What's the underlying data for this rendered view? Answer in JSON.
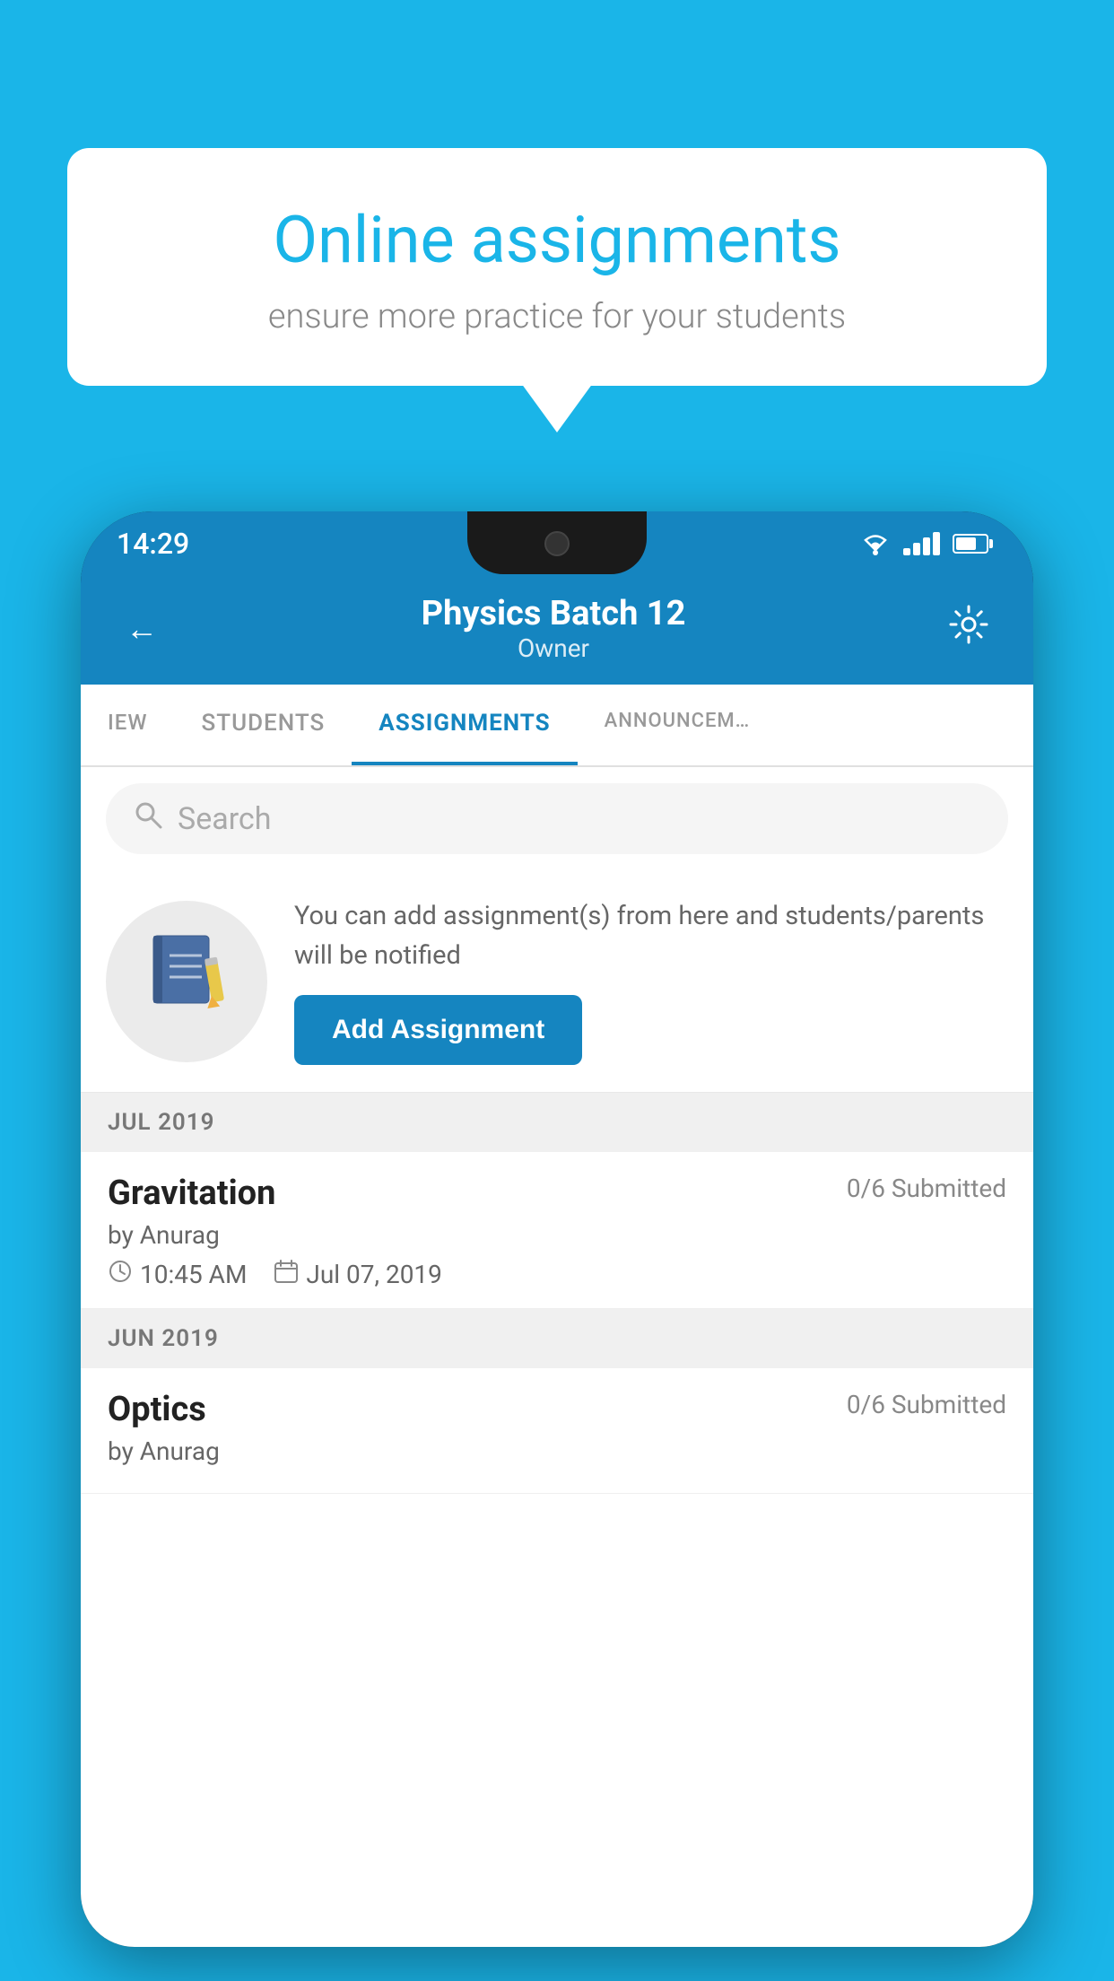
{
  "background_color": "#1ab5e8",
  "speech_bubble": {
    "title": "Online assignments",
    "subtitle": "ensure more practice for your students"
  },
  "status_bar": {
    "time": "14:29"
  },
  "header": {
    "title": "Physics Batch 12",
    "subtitle": "Owner",
    "back_label": "←",
    "settings_label": "⚙"
  },
  "tabs": [
    {
      "label": "IEW",
      "active": false
    },
    {
      "label": "STUDENTS",
      "active": false
    },
    {
      "label": "ASSIGNMENTS",
      "active": true
    },
    {
      "label": "ANNOUNCEM…",
      "active": false
    }
  ],
  "search": {
    "placeholder": "Search"
  },
  "promo": {
    "description": "You can add assignment(s) from here and students/parents will be notified",
    "button_label": "Add Assignment"
  },
  "sections": [
    {
      "header": "JUL 2019",
      "assignments": [
        {
          "title": "Gravitation",
          "submitted": "0/6 Submitted",
          "by": "by Anurag",
          "time": "10:45 AM",
          "date": "Jul 07, 2019"
        }
      ]
    },
    {
      "header": "JUN 2019",
      "assignments": [
        {
          "title": "Optics",
          "submitted": "0/6 Submitted",
          "by": "by Anurag",
          "time": "",
          "date": ""
        }
      ]
    }
  ]
}
